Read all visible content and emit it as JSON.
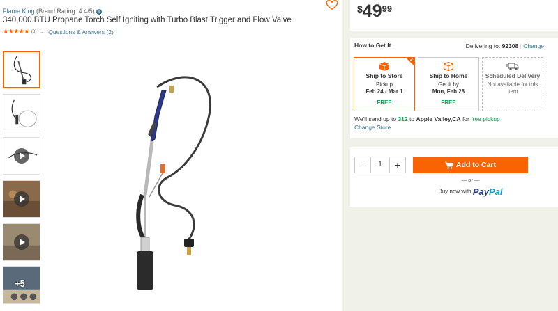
{
  "product": {
    "brand": "Flame King",
    "brand_rating": "(Brand Rating: 4.4/5)",
    "title": "340,000 BTU Propane Torch Self Igniting with Turbo Blast Trigger and Flow Valve",
    "stars": "★★★★★",
    "review_count": "(8)",
    "qa_link": "Questions & Answers (2)"
  },
  "gallery": {
    "more_label": "+5"
  },
  "price": {
    "currency": "$",
    "dollars": "49",
    "cents": "99"
  },
  "fulfillment": {
    "heading": "How to Get It",
    "delivering_label": "Delivering to:",
    "zip": "92308",
    "separator": "|",
    "change_link": "Change",
    "options": [
      {
        "title": "Ship to Store",
        "line1": "Pickup",
        "line2": "Feb 24 - Mar 1",
        "price": "FREE",
        "icon": "store-box-icon"
      },
      {
        "title": "Ship to Home",
        "line1": "Get it by",
        "line2": "Mon, Feb 28",
        "price": "FREE",
        "icon": "box-icon"
      },
      {
        "title": "Scheduled Delivery",
        "line1": "Not available for this item",
        "icon": "truck-icon"
      }
    ],
    "send_prefix": "We'll send up to",
    "send_qty": "312",
    "send_to": "to",
    "send_store": "Apple Valley,CA",
    "send_for": "for",
    "send_free": "free pickup",
    "change_store": "Change Store"
  },
  "cart": {
    "minus": "-",
    "quantity": "1",
    "plus": "+",
    "add_label": "Add to Cart",
    "or_text": "— or —",
    "buy_now": "Buy now with",
    "paypal_1": "Pay",
    "paypal_2": "Pal"
  },
  "colors": {
    "accent": "#f96302",
    "link": "#3e7697",
    "free": "#00a650"
  }
}
